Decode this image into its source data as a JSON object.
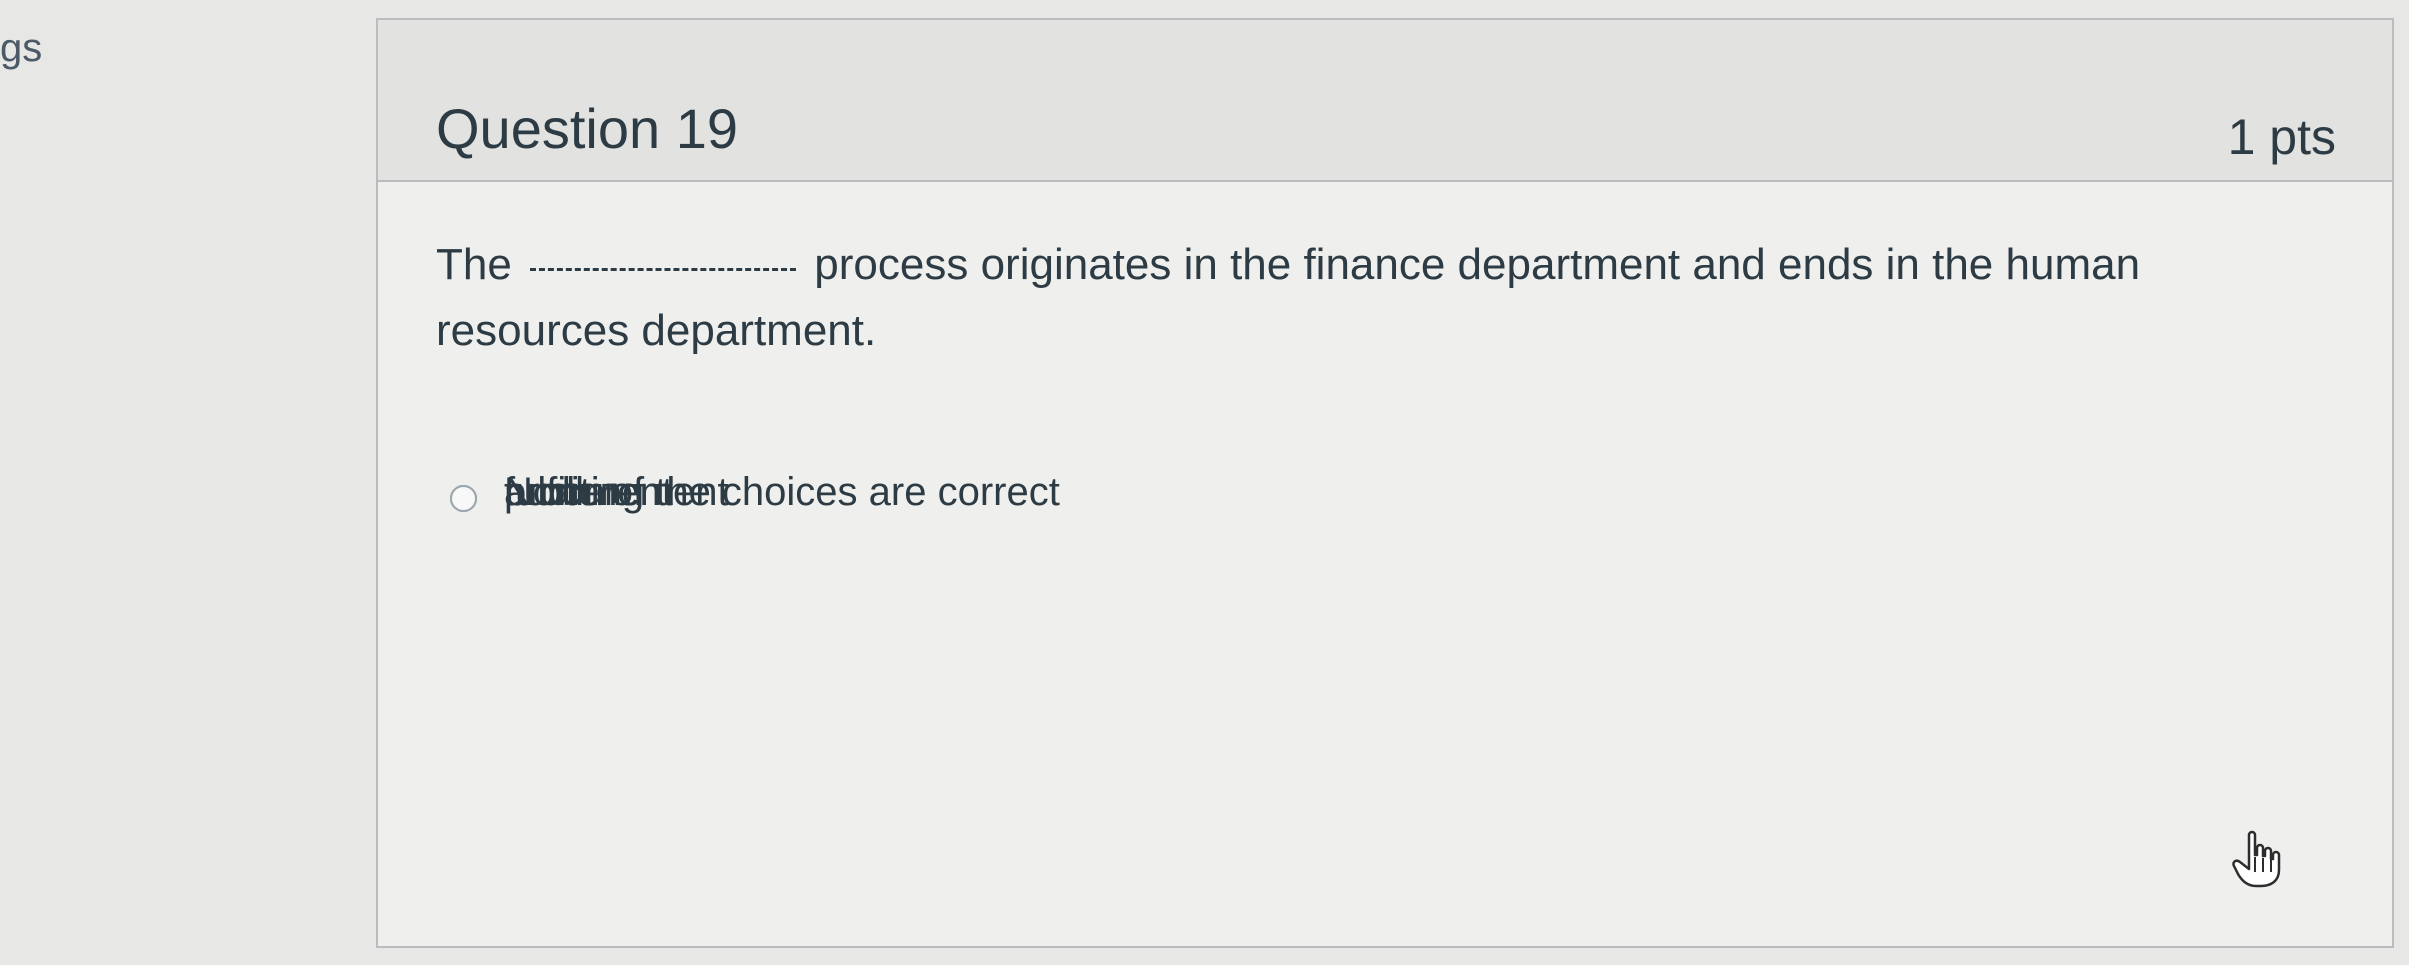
{
  "sidebar": {
    "partial_text": "gs"
  },
  "question": {
    "title": "Question 19",
    "points": "1 pts",
    "text_before_blank": "The",
    "text_after_blank": "process originates in the finance department and ends in the human resources department."
  },
  "answers": [
    {
      "label": "procurement",
      "selected": false
    },
    {
      "label": "fulfillment",
      "selected": false
    },
    {
      "label": "auditing",
      "selected": false
    },
    {
      "label": "None of the choices are correct",
      "selected": false
    }
  ],
  "icons": {
    "cursor": "hand-pointer-icon",
    "blank": "fill-in-blank-line"
  }
}
